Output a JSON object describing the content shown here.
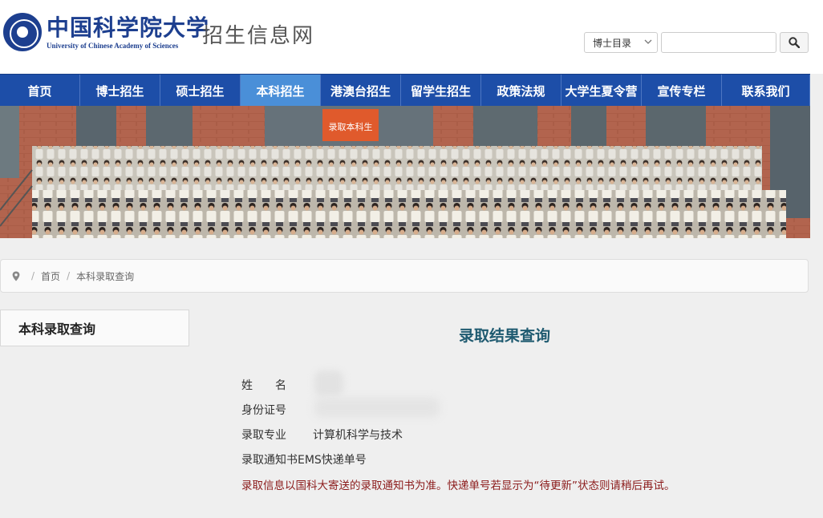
{
  "header": {
    "logo_cn": "中国科学院大学",
    "logo_en": "University of Chinese Academy of Sciences",
    "site_name": "招生信息网"
  },
  "search": {
    "select_value": "博士目录",
    "input_value": "",
    "button_icon": "search-icon"
  },
  "nav": {
    "items": [
      "首页",
      "博士招生",
      "硕士招生",
      "本科招生",
      "港澳台招生",
      "留学生招生",
      "政策法规",
      "大学生夏令营",
      "宣传专栏",
      "联系我们"
    ],
    "active": "本科招生"
  },
  "banner": {
    "flag_text": "录取本科生"
  },
  "breadcrumb": {
    "home": "首页",
    "current": "本科录取查询",
    "separator": "/"
  },
  "sidebar": {
    "title": "本科录取查询"
  },
  "main": {
    "title": "录取结果查询",
    "fields": {
      "name_label": "姓　　名",
      "id_label": "身份证号",
      "major_label": "录取专业",
      "major_value": "计算机科学与技术",
      "ems_label": "录取通知书EMS快递单号"
    },
    "notice": "录取信息以国科大寄送的录取通知书为准。快递单号若显示为“待更新”状态则请稍后再试。"
  },
  "colors": {
    "nav_bg": "#1d4ea8",
    "nav_active": "#4a8fd8",
    "title": "#1f5a70",
    "notice": "#8b1a1a",
    "brand": "#1d3f8f"
  }
}
